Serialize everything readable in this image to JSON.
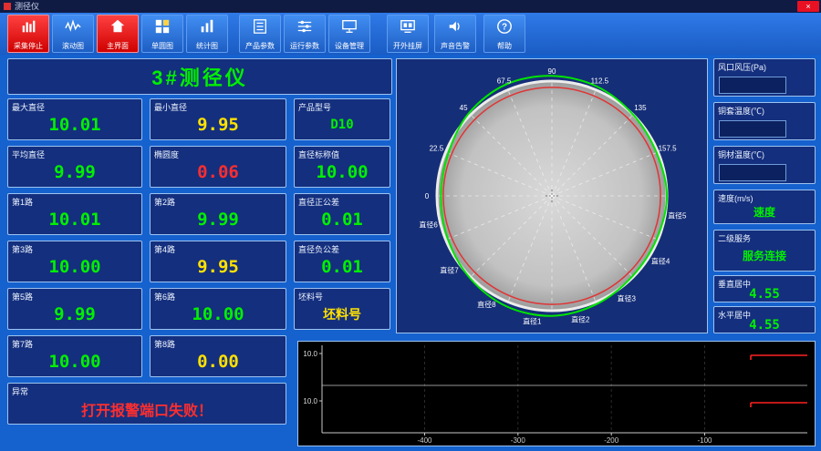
{
  "window": {
    "title": "测径仪",
    "close_label": "×"
  },
  "colors": {
    "green": "#00f000",
    "yellow": "#ffe100",
    "red": "#ff2e2e",
    "white": "#ffffff"
  },
  "toolbar": {
    "buttons": [
      {
        "label": "采集停止",
        "icon": "acquisition-stop",
        "active": true
      },
      {
        "label": "滚动图",
        "icon": "scroll-chart",
        "active": false
      },
      {
        "label": "主界面",
        "icon": "home",
        "active": true
      },
      {
        "label": "单圆图",
        "icon": "single-chart",
        "active": false
      },
      {
        "label": "统计图",
        "icon": "stats-chart",
        "active": false
      },
      {
        "label": "产品参数",
        "icon": "product-params",
        "active": false
      },
      {
        "label": "运行参数",
        "icon": "run-params",
        "active": false
      },
      {
        "label": "设备管理",
        "icon": "device-manage",
        "active": false
      },
      {
        "label": "开外挂屏",
        "icon": "external-screen",
        "active": false
      },
      {
        "label": "声音告警",
        "icon": "sound-alarm",
        "active": false
      },
      {
        "label": "帮助",
        "icon": "help",
        "active": false
      }
    ]
  },
  "main_title": "3#测径仪",
  "fields": [
    {
      "label": "最大直径",
      "value": "10.01",
      "color": "green"
    },
    {
      "label": "最小直径",
      "value": "9.95",
      "color": "yellow"
    },
    {
      "label": "产品型号",
      "value": "D10",
      "color": "green"
    },
    {
      "label": "平均直径",
      "value": "9.99",
      "color": "green"
    },
    {
      "label": "椭圆度",
      "value": "0.06",
      "color": "red"
    },
    {
      "label": "直径标称值",
      "value": "10.00",
      "color": "green"
    },
    {
      "label": "第1路",
      "value": "10.01",
      "color": "green"
    },
    {
      "label": "第2路",
      "value": "9.99",
      "color": "green"
    },
    {
      "label": "直径正公差",
      "value": "0.01",
      "color": "green"
    },
    {
      "label": "第3路",
      "value": "10.00",
      "color": "green"
    },
    {
      "label": "第4路",
      "value": "9.95",
      "color": "yellow"
    },
    {
      "label": "直径负公差",
      "value": "0.01",
      "color": "green"
    },
    {
      "label": "第5路",
      "value": "9.99",
      "color": "green"
    },
    {
      "label": "第6路",
      "value": "10.00",
      "color": "green"
    },
    {
      "label": "坯料号",
      "value": "坯料号",
      "color": "yellow"
    },
    {
      "label": "第7路",
      "value": "10.00",
      "color": "green"
    },
    {
      "label": "第8路",
      "value": "0.00",
      "color": "yellow"
    },
    {
      "label": "异常",
      "value": "打开报警端口失败！",
      "color": "red",
      "wide": true
    }
  ],
  "right_panel": {
    "items": [
      {
        "label": "风口风压(Pa)",
        "value": "",
        "style": "inset"
      },
      {
        "label": "铜套温度(℃)",
        "value": "",
        "style": "inset"
      },
      {
        "label": "铜材温度(℃)",
        "value": "",
        "style": "inset"
      },
      {
        "label": "速度(m/s)",
        "value": "速度",
        "color": "green"
      },
      {
        "label": "二级服务",
        "value": "服务连接",
        "color": "green"
      },
      {
        "label": "垂直居中",
        "value": "4.55",
        "color": "green"
      },
      {
        "label": "水平居中",
        "value": "4.55",
        "color": "green"
      }
    ]
  },
  "chart_data": [
    {
      "type": "radar",
      "angle_labels": [
        "0",
        "22.5",
        "45",
        "67.5",
        "90",
        "112.5",
        "135",
        "157.5"
      ],
      "diameter_labels": [
        "直径1",
        "直径2",
        "直径3",
        "直径4",
        "直径5",
        "直径6",
        "直径7",
        "直径8"
      ],
      "nominal_diameter": 10.0,
      "profile_fractions": [
        1.0,
        0.985,
        1.0,
        1.03,
        1.045,
        1.05,
        1.02,
        0.975,
        0.965,
        0.98,
        1.01,
        1.04,
        1.045,
        1.02,
        0.99,
        0.985
      ],
      "tolerance_fraction": 0.945,
      "profile_color": "#00e400",
      "tolerance_color": "#e03434"
    },
    {
      "type": "line",
      "subplots": [
        {
          "ytick": "10.0",
          "limit_value": 10.0
        },
        {
          "ytick": "10.0",
          "limit_value": 10.0
        }
      ],
      "xticks": [
        "-400",
        "-300",
        "-200",
        "-100"
      ],
      "xrange": [
        -510,
        10
      ],
      "line_color": "#ff2020"
    }
  ]
}
